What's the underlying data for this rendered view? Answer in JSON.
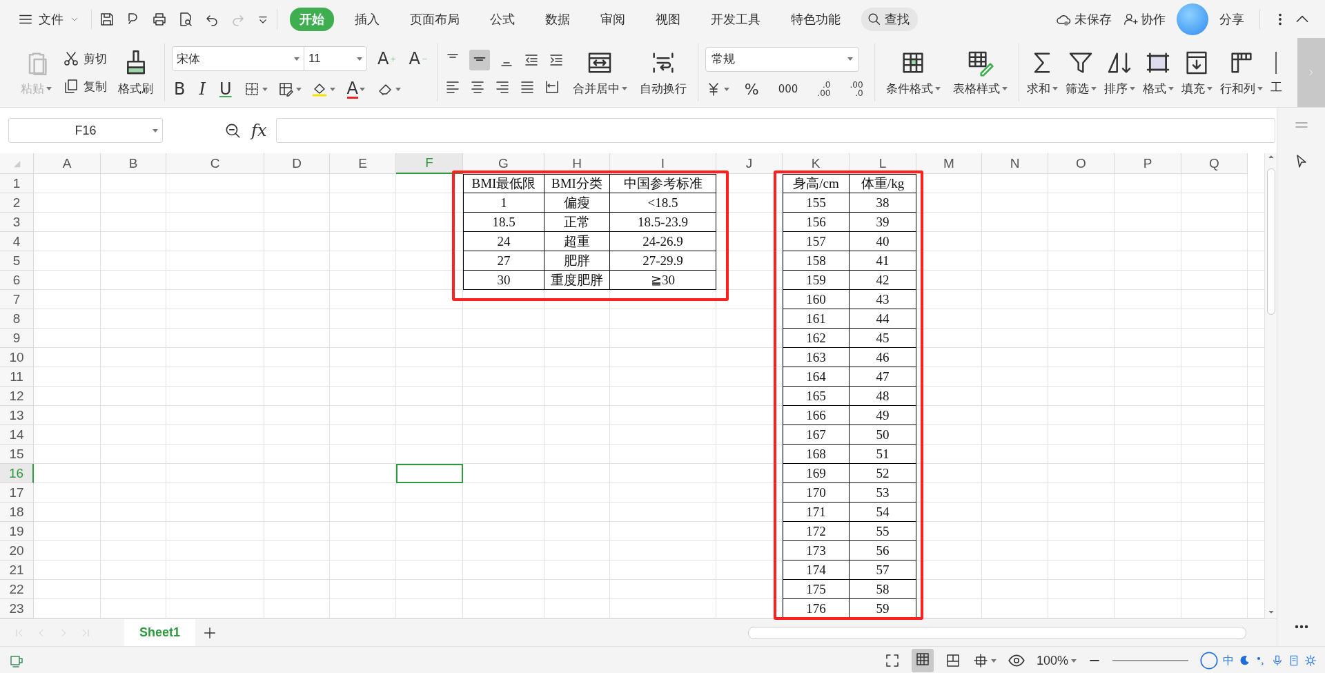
{
  "title_bar": {
    "file_menu": "文件",
    "tabs": [
      {
        "label": "开始",
        "selected": true
      },
      {
        "label": "插入",
        "selected": false
      },
      {
        "label": "页面布局",
        "selected": false
      },
      {
        "label": "公式",
        "selected": false
      },
      {
        "label": "数据",
        "selected": false
      },
      {
        "label": "审阅",
        "selected": false
      },
      {
        "label": "视图",
        "selected": false
      },
      {
        "label": "开发工具",
        "selected": false
      },
      {
        "label": "特色功能",
        "selected": false
      }
    ],
    "search": "查找",
    "save_status": "未保存",
    "collaborate": "协作",
    "share": "分享"
  },
  "ribbon": {
    "clipboard": {
      "paste": {
        "label": "粘贴",
        "disabled": true
      },
      "cut": "剪切",
      "copy": "复制",
      "format_painter": "格式刷"
    },
    "font": {
      "family": "宋体",
      "size": "11",
      "grow": "A",
      "shrink": "A",
      "styles": [
        "B",
        "I",
        "U"
      ],
      "font_color": "A"
    },
    "alignment": {
      "merge": "合并居中",
      "wrap": "自动换行"
    },
    "number": {
      "format": "常规",
      "percent": "%",
      "thousands": "000",
      "add_decimal": [
        ".0",
        ".00"
      ],
      "remove_decimal": [
        ".00",
        ".0"
      ]
    },
    "styles": [
      "条件格式",
      "表格样式"
    ],
    "editing": [
      "求和",
      "筛选",
      "排序",
      "格式",
      "填充",
      "行和列",
      "工"
    ]
  },
  "formula_bar": {
    "name_box": "F16",
    "fx": "fx"
  },
  "sheet": {
    "columns": [
      {
        "label": "A",
        "selected": false
      },
      {
        "label": "B",
        "selected": false
      },
      {
        "label": "C",
        "selected": false
      },
      {
        "label": "D",
        "selected": false
      },
      {
        "label": "E",
        "selected": false
      },
      {
        "label": "F",
        "selected": true
      },
      {
        "label": "G",
        "selected": false
      },
      {
        "label": "H",
        "selected": false
      },
      {
        "label": "I",
        "selected": false
      },
      {
        "label": "J",
        "selected": false
      },
      {
        "label": "K",
        "selected": false
      },
      {
        "label": "L",
        "selected": false
      },
      {
        "label": "M",
        "selected": false
      },
      {
        "label": "N",
        "selected": false
      },
      {
        "label": "O",
        "selected": false
      },
      {
        "label": "P",
        "selected": false
      },
      {
        "label": "Q",
        "selected": false
      }
    ],
    "rows": [
      {
        "label": "1",
        "selected": false
      },
      {
        "label": "2",
        "selected": false
      },
      {
        "label": "3",
        "selected": false
      },
      {
        "label": "4",
        "selected": false
      },
      {
        "label": "5",
        "selected": false
      },
      {
        "label": "6",
        "selected": false
      },
      {
        "label": "7",
        "selected": false
      },
      {
        "label": "8",
        "selected": false
      },
      {
        "label": "9",
        "selected": false
      },
      {
        "label": "10",
        "selected": false
      },
      {
        "label": "11",
        "selected": false
      },
      {
        "label": "12",
        "selected": false
      },
      {
        "label": "13",
        "selected": false
      },
      {
        "label": "14",
        "selected": false
      },
      {
        "label": "15",
        "selected": false
      },
      {
        "label": "16",
        "selected": true
      },
      {
        "label": "17",
        "selected": false
      },
      {
        "label": "18",
        "selected": false
      },
      {
        "label": "19",
        "selected": false
      },
      {
        "label": "20",
        "selected": false
      },
      {
        "label": "21",
        "selected": false
      },
      {
        "label": "22",
        "selected": false
      },
      {
        "label": "23",
        "selected": false
      }
    ],
    "bmi_table": {
      "columns": [
        "BMI最低限",
        "BMI分类",
        "中国参考标准"
      ],
      "rows": [
        [
          "1",
          "偏瘦",
          "<18.5"
        ],
        [
          "18.5",
          "正常",
          "18.5-23.9"
        ],
        [
          "24",
          "超重",
          "24-26.9"
        ],
        [
          "27",
          "肥胖",
          "27-29.9"
        ],
        [
          "30",
          "重度肥胖",
          "≧30"
        ]
      ]
    },
    "height_weight_table": {
      "columns": [
        "身高/cm",
        "体重/kg"
      ],
      "rows": [
        [
          "155",
          "38"
        ],
        [
          "156",
          "39"
        ],
        [
          "157",
          "40"
        ],
        [
          "158",
          "41"
        ],
        [
          "159",
          "42"
        ],
        [
          "160",
          "43"
        ],
        [
          "161",
          "44"
        ],
        [
          "162",
          "45"
        ],
        [
          "163",
          "46"
        ],
        [
          "164",
          "47"
        ],
        [
          "165",
          "48"
        ],
        [
          "166",
          "49"
        ],
        [
          "167",
          "50"
        ],
        [
          "168",
          "51"
        ],
        [
          "169",
          "52"
        ],
        [
          "170",
          "53"
        ],
        [
          "171",
          "54"
        ],
        [
          "172",
          "55"
        ],
        [
          "173",
          "56"
        ],
        [
          "174",
          "57"
        ],
        [
          "175",
          "58"
        ],
        [
          "176",
          "59"
        ]
      ]
    }
  },
  "sheet_tabs": [
    {
      "label": "Sheet1",
      "selected": true
    }
  ],
  "status_bar": {
    "zoom": "100%",
    "ime": "中"
  }
}
